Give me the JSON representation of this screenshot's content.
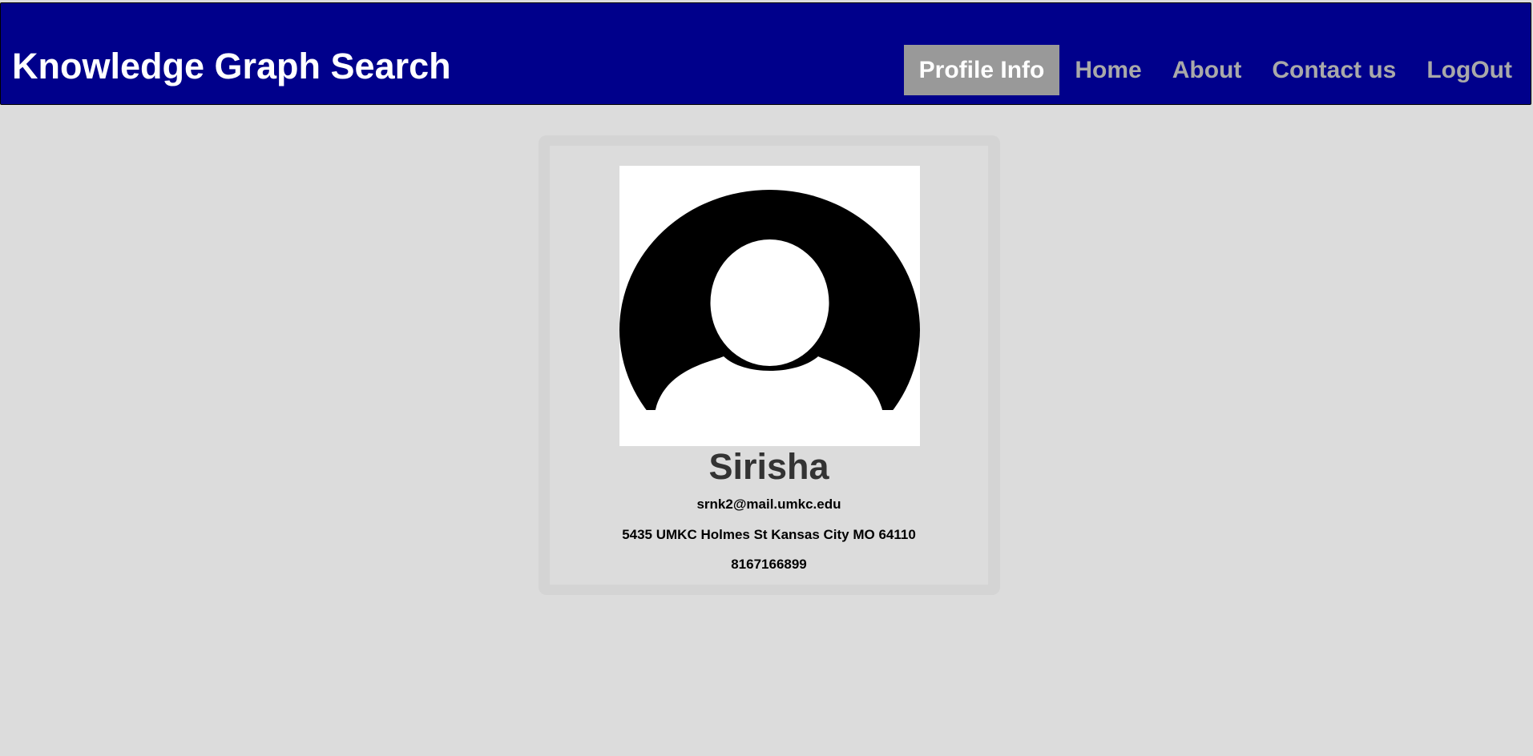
{
  "header": {
    "title": "Knowledge Graph Search",
    "nav": [
      {
        "label": "Profile Info",
        "active": true
      },
      {
        "label": "Home",
        "active": false
      },
      {
        "label": "About",
        "active": false
      },
      {
        "label": "Contact us",
        "active": false
      },
      {
        "label": "LogOut",
        "active": false
      }
    ]
  },
  "profile": {
    "avatar_icon": "user-avatar-icon",
    "name": "Sirisha",
    "email": "srnk2@mail.umkc.edu",
    "address": "5435 UMKC Holmes St Kansas City MO 64110",
    "phone": "8167166899"
  },
  "colors": {
    "navbar": "#00008b",
    "active_tab": "#999999",
    "nav_text": "#a9a9a9",
    "background": "#dcdcdc"
  }
}
